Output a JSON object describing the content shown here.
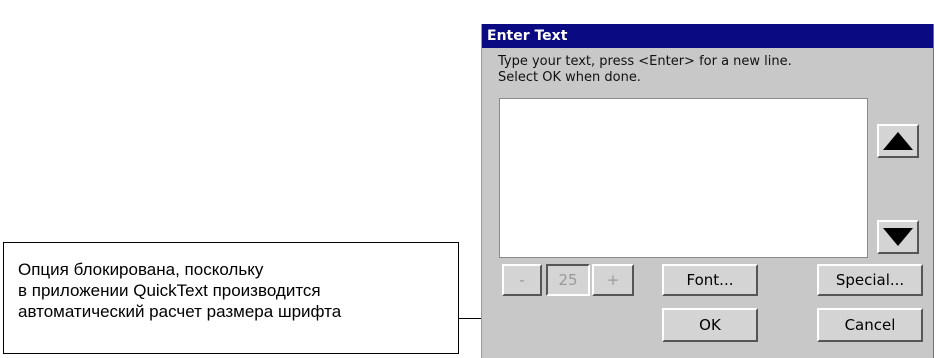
{
  "dialog": {
    "title": "Enter Text",
    "instruction_line1": "Type your text, press <Enter> for a new line.",
    "instruction_line2": "Select OK when done.",
    "text_value": "",
    "font_size": {
      "minus_label": "-",
      "value": "25",
      "plus_label": "+"
    },
    "font_button": "Font...",
    "special_button": "Special...",
    "ok_button": "OK",
    "cancel_button": "Cancel",
    "scroll_up_icon": "triangle-up-icon",
    "scroll_down_icon": "triangle-down-icon"
  },
  "callout": {
    "line1": "Опция блокирована, поскольку",
    "line2": "в приложении QuickText производится",
    "line3": "автоматический расчет размера шрифта"
  },
  "colors": {
    "titlebar": "#0a0a82",
    "dialog_bg": "#c8c8c8"
  }
}
